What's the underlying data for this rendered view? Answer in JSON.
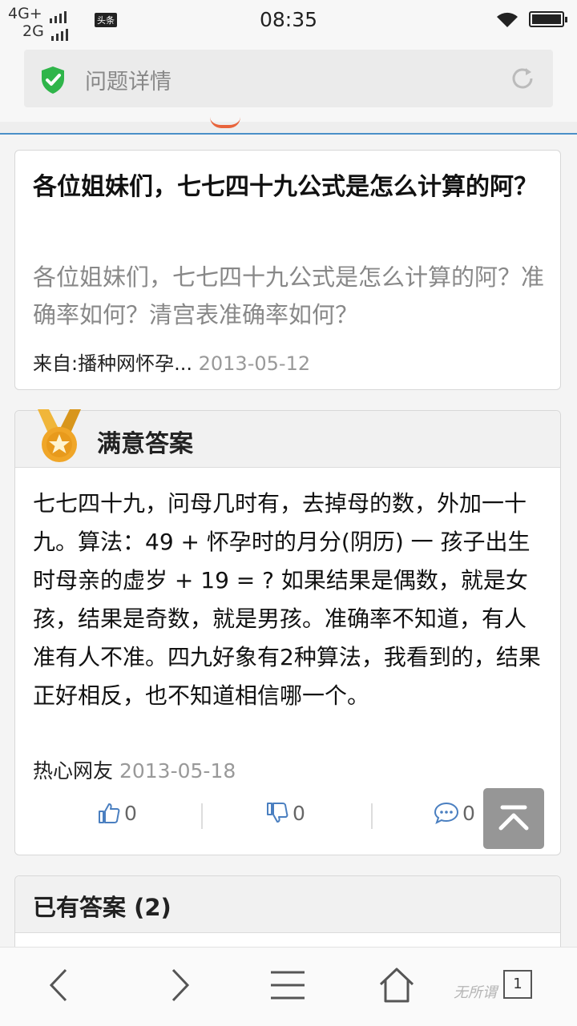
{
  "status_bar": {
    "network_top": "4G+",
    "network_bottom": "2G",
    "app_badge": "头条",
    "time": "08:35"
  },
  "address_bar": {
    "title": "问题详情"
  },
  "question": {
    "title": "各位姐妹们，七七四十九公式是怎么计算的阿？",
    "description": "各位姐妹们，七七四十九公式是怎么计算的阿？准确率如何？清宫表准确率如何？",
    "source": "来自:播种网怀孕...",
    "date": "2013-05-12"
  },
  "best_answer": {
    "heading": "满意答案",
    "body": "七七四十九，问母几时有，去掉母的数，外加一十九。算法：49 + 怀孕时的月分(阴历) 一 孩子出生时母亲的虚岁 + 19 = ? 如果结果是偶数，就是女孩，结果是奇数，就是男孩。准确率不知道，有人准有人不准。四九好象有2种算法，我看到的，结果正好相反，也不知道相信哪一个。",
    "author": "热心网友",
    "date": "2013-05-18",
    "likes": "0",
    "dislikes": "0",
    "comments": "0"
  },
  "answers_section": {
    "heading": "已有答案 (2)"
  },
  "bottom_nav": {
    "tab_count": "1",
    "watermark": "无所谓"
  },
  "colors": {
    "shield": "#2fb54a",
    "accent_line": "#4a90c8",
    "medal": "#e8a020"
  }
}
